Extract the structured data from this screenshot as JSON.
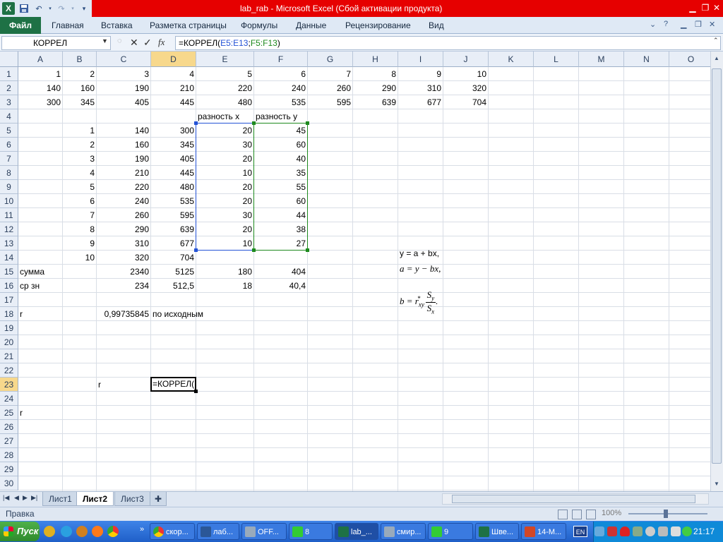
{
  "window": {
    "title": "lab_rab  -  Microsoft Excel (Сбой активации продукта)"
  },
  "ribbon": {
    "file_tab": "Файл",
    "tabs": [
      "Главная",
      "Вставка",
      "Разметка страницы",
      "Формулы",
      "Данные",
      "Рецензирование",
      "Вид"
    ]
  },
  "formula_bar": {
    "name_box": "КОРРЕЛ",
    "fx": "fx",
    "formula_prefix": "=КОРРЕЛ(",
    "ref1": "E5:E13",
    "sep": ";",
    "ref2": "F5:F13",
    "formula_suffix": ")"
  },
  "columns": [
    "A",
    "B",
    "C",
    "D",
    "E",
    "F",
    "G",
    "H",
    "I",
    "J",
    "K",
    "L",
    "M",
    "N",
    "O"
  ],
  "rows": [
    1,
    2,
    3,
    4,
    5,
    6,
    7,
    8,
    9,
    10,
    11,
    12,
    13,
    14,
    15,
    16,
    17,
    18,
    19,
    20,
    21,
    22,
    23,
    24,
    25,
    26,
    27,
    28,
    29,
    30
  ],
  "cells": [
    {
      "ref": "A1",
      "v": "1",
      "t": "n"
    },
    {
      "ref": "B1",
      "v": "2",
      "t": "n"
    },
    {
      "ref": "C1",
      "v": "3",
      "t": "n"
    },
    {
      "ref": "D1",
      "v": "4",
      "t": "n"
    },
    {
      "ref": "E1",
      "v": "5",
      "t": "n"
    },
    {
      "ref": "F1",
      "v": "6",
      "t": "n"
    },
    {
      "ref": "G1",
      "v": "7",
      "t": "n"
    },
    {
      "ref": "H1",
      "v": "8",
      "t": "n"
    },
    {
      "ref": "I1",
      "v": "9",
      "t": "n"
    },
    {
      "ref": "J1",
      "v": "10",
      "t": "n"
    },
    {
      "ref": "A2",
      "v": "140",
      "t": "n"
    },
    {
      "ref": "B2",
      "v": "160",
      "t": "n"
    },
    {
      "ref": "C2",
      "v": "190",
      "t": "n"
    },
    {
      "ref": "D2",
      "v": "210",
      "t": "n"
    },
    {
      "ref": "E2",
      "v": "220",
      "t": "n"
    },
    {
      "ref": "F2",
      "v": "240",
      "t": "n"
    },
    {
      "ref": "G2",
      "v": "260",
      "t": "n"
    },
    {
      "ref": "H2",
      "v": "290",
      "t": "n"
    },
    {
      "ref": "I2",
      "v": "310",
      "t": "n"
    },
    {
      "ref": "J2",
      "v": "320",
      "t": "n"
    },
    {
      "ref": "A3",
      "v": "300",
      "t": "n"
    },
    {
      "ref": "B3",
      "v": "345",
      "t": "n"
    },
    {
      "ref": "C3",
      "v": "405",
      "t": "n"
    },
    {
      "ref": "D3",
      "v": "445",
      "t": "n"
    },
    {
      "ref": "E3",
      "v": "480",
      "t": "n"
    },
    {
      "ref": "F3",
      "v": "535",
      "t": "n"
    },
    {
      "ref": "G3",
      "v": "595",
      "t": "n"
    },
    {
      "ref": "H3",
      "v": "639",
      "t": "n"
    },
    {
      "ref": "I3",
      "v": "677",
      "t": "n"
    },
    {
      "ref": "J3",
      "v": "704",
      "t": "n"
    },
    {
      "ref": "E4",
      "v": "разность x",
      "t": "s"
    },
    {
      "ref": "F4",
      "v": "разность y",
      "t": "s"
    },
    {
      "ref": "B5",
      "v": "1",
      "t": "n"
    },
    {
      "ref": "C5",
      "v": "140",
      "t": "n"
    },
    {
      "ref": "D5",
      "v": "300",
      "t": "n"
    },
    {
      "ref": "E5",
      "v": "20",
      "t": "n"
    },
    {
      "ref": "F5",
      "v": "45",
      "t": "n"
    },
    {
      "ref": "B6",
      "v": "2",
      "t": "n"
    },
    {
      "ref": "C6",
      "v": "160",
      "t": "n"
    },
    {
      "ref": "D6",
      "v": "345",
      "t": "n"
    },
    {
      "ref": "E6",
      "v": "30",
      "t": "n"
    },
    {
      "ref": "F6",
      "v": "60",
      "t": "n"
    },
    {
      "ref": "B7",
      "v": "3",
      "t": "n"
    },
    {
      "ref": "C7",
      "v": "190",
      "t": "n"
    },
    {
      "ref": "D7",
      "v": "405",
      "t": "n"
    },
    {
      "ref": "E7",
      "v": "20",
      "t": "n"
    },
    {
      "ref": "F7",
      "v": "40",
      "t": "n"
    },
    {
      "ref": "B8",
      "v": "4",
      "t": "n"
    },
    {
      "ref": "C8",
      "v": "210",
      "t": "n"
    },
    {
      "ref": "D8",
      "v": "445",
      "t": "n"
    },
    {
      "ref": "E8",
      "v": "10",
      "t": "n"
    },
    {
      "ref": "F8",
      "v": "35",
      "t": "n"
    },
    {
      "ref": "B9",
      "v": "5",
      "t": "n"
    },
    {
      "ref": "C9",
      "v": "220",
      "t": "n"
    },
    {
      "ref": "D9",
      "v": "480",
      "t": "n"
    },
    {
      "ref": "E9",
      "v": "20",
      "t": "n"
    },
    {
      "ref": "F9",
      "v": "55",
      "t": "n"
    },
    {
      "ref": "B10",
      "v": "6",
      "t": "n"
    },
    {
      "ref": "C10",
      "v": "240",
      "t": "n"
    },
    {
      "ref": "D10",
      "v": "535",
      "t": "n"
    },
    {
      "ref": "E10",
      "v": "20",
      "t": "n"
    },
    {
      "ref": "F10",
      "v": "60",
      "t": "n"
    },
    {
      "ref": "B11",
      "v": "7",
      "t": "n"
    },
    {
      "ref": "C11",
      "v": "260",
      "t": "n"
    },
    {
      "ref": "D11",
      "v": "595",
      "t": "n"
    },
    {
      "ref": "E11",
      "v": "30",
      "t": "n"
    },
    {
      "ref": "F11",
      "v": "44",
      "t": "n"
    },
    {
      "ref": "B12",
      "v": "8",
      "t": "n"
    },
    {
      "ref": "C12",
      "v": "290",
      "t": "n"
    },
    {
      "ref": "D12",
      "v": "639",
      "t": "n"
    },
    {
      "ref": "E12",
      "v": "20",
      "t": "n"
    },
    {
      "ref": "F12",
      "v": "38",
      "t": "n"
    },
    {
      "ref": "B13",
      "v": "9",
      "t": "n"
    },
    {
      "ref": "C13",
      "v": "310",
      "t": "n"
    },
    {
      "ref": "D13",
      "v": "677",
      "t": "n"
    },
    {
      "ref": "E13",
      "v": "10",
      "t": "n"
    },
    {
      "ref": "F13",
      "v": "27",
      "t": "n"
    },
    {
      "ref": "B14",
      "v": "10",
      "t": "n"
    },
    {
      "ref": "C14",
      "v": "320",
      "t": "n"
    },
    {
      "ref": "D14",
      "v": "704",
      "t": "n"
    },
    {
      "ref": "A15",
      "v": "сумма",
      "t": "s"
    },
    {
      "ref": "C15",
      "v": "2340",
      "t": "n"
    },
    {
      "ref": "D15",
      "v": "5125",
      "t": "n"
    },
    {
      "ref": "E15",
      "v": "180",
      "t": "n"
    },
    {
      "ref": "F15",
      "v": "404",
      "t": "n"
    },
    {
      "ref": "A16",
      "v": "ср зн",
      "t": "s"
    },
    {
      "ref": "C16",
      "v": "234",
      "t": "n"
    },
    {
      "ref": "D16",
      "v": "512,5",
      "t": "n"
    },
    {
      "ref": "E16",
      "v": "18",
      "t": "n"
    },
    {
      "ref": "F16",
      "v": "40,4",
      "t": "n"
    },
    {
      "ref": "A18",
      "v": "r",
      "t": "s"
    },
    {
      "ref": "C18",
      "v": "0,99735845",
      "t": "n"
    },
    {
      "ref": "D18",
      "v": "по исходным",
      "t": "s"
    },
    {
      "ref": "C23",
      "v": "r",
      "t": "s"
    },
    {
      "ref": "A25",
      "v": "r",
      "t": "s"
    }
  ],
  "active_cell": {
    "ref": "D23",
    "text": "=КОРРЕЛ("
  },
  "math_note": {
    "line1": "y = a + bx,",
    "line2": "a = y − bx,",
    "line3_lhs": "b = r",
    "line3_sub": "xy",
    "line3_mul": "*",
    "line3_num": "S",
    "line3_num_sub": "y",
    "line3_den": "S",
    "line3_den_sub": "x",
    "line3_end": "."
  },
  "sheets": {
    "tabs": [
      "Лист1",
      "Лист2",
      "Лист3"
    ],
    "active": "Лист2"
  },
  "status": {
    "mode": "Правка",
    "zoom": "100%"
  },
  "taskbar": {
    "start": "Пуск",
    "buttons": [
      "скор...",
      "лаб...",
      "OFF...",
      "8",
      "lab_...",
      "смир...",
      "9",
      "Шве...",
      "14-М..."
    ],
    "active_button": "lab_...",
    "lang": "EN",
    "clock": "21:17"
  },
  "colors": {
    "title_bar": "#e60000",
    "excel_green": "#1e7145",
    "ref_blue": "#2453d6",
    "ref_green": "#1e8a1e",
    "taskbar_blue": "#1f5fc8"
  }
}
